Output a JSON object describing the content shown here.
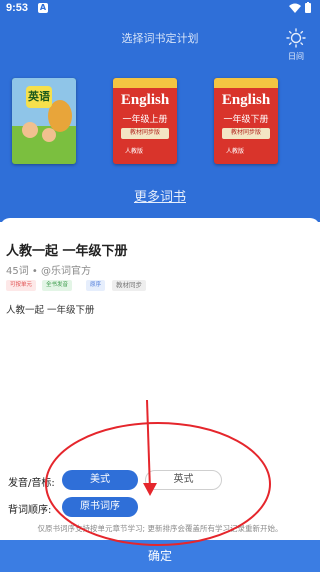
{
  "status_bar": {
    "time": "9:53",
    "notif_icon_text": "A"
  },
  "header": {
    "title": "选择词书定计划",
    "night_label": "日间"
  },
  "books": [
    {
      "cover_title": "英语",
      "style": "illustrated"
    },
    {
      "cover_title": "English",
      "grade": "一年级上册",
      "tag": "教材同步版",
      "publisher": "人教版"
    },
    {
      "cover_title": "English",
      "grade": "一年级下册",
      "tag": "教材同步版",
      "publisher": "人教版"
    }
  ],
  "more_books_label": "更多词书",
  "detail": {
    "name": "人教一起 一年级下册",
    "meta": "45词 • @乐词官方",
    "tags": [
      "可按单元",
      "全书发音",
      "原序",
      "教材同步"
    ],
    "description": "人教一起 一年级下册"
  },
  "settings": {
    "pron_label": "发音/音标:",
    "pron_options": [
      "美式",
      "英式"
    ],
    "order_label": "背词顺序:",
    "order_option": "原书词序",
    "hint": "仅原书词序支持按单元章节学习; 更新排序会覆盖所有学习记录重新开始。"
  },
  "confirm_label": "确定",
  "colors": {
    "primary": "#2f6fd8",
    "annotation": "#e5262c"
  }
}
